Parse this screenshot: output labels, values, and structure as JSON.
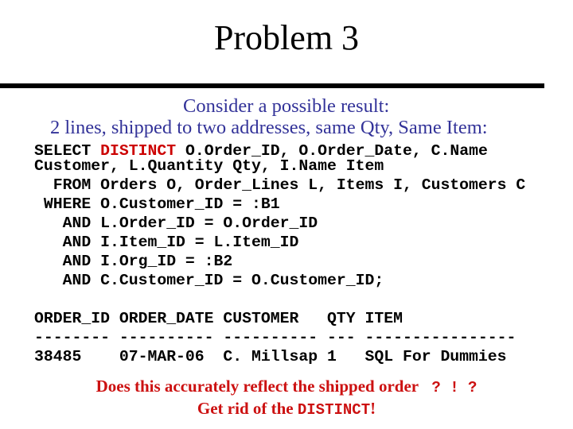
{
  "slide": {
    "title": "Problem 3",
    "subtitle_lines": [
      "Consider a possible result:",
      "2 lines, shipped to two addresses, same Qty, Same Item:"
    ],
    "colors": {
      "title": "#000000",
      "subtitle": "#333399",
      "code": "#000000",
      "highlight": "#cc0000"
    }
  },
  "sql": {
    "line1_prefix": "SELECT ",
    "line1_keyword": "DISTINCT",
    "line1_rest": " O.Order_ID, O.Order_Date, C.Name",
    "line2": "Customer, L.Quantity Qty, I.Name Item",
    "lines": [
      "  FROM Orders O, Order_Lines L, Items I, Customers C",
      " WHERE O.Customer_ID = :B1",
      "   AND L.Order_ID = O.Order_ID",
      "   AND I.Item_ID = L.Item_ID",
      "   AND I.Org_ID = :B2",
      "   AND C.Customer_ID = O.Customer_ID;"
    ]
  },
  "result": {
    "header": "ORDER_ID ORDER_DATE CUSTOMER   QTY ITEM",
    "separator": "-------- ---------- ---------- --- ----------------",
    "columns": [
      "ORDER_ID",
      "ORDER_DATE",
      "CUSTOMER",
      "QTY",
      "ITEM"
    ],
    "rows": [
      {
        "text": "38485    07-MAR-06  C. Millsap 1   SQL For Dummies",
        "ORDER_ID": "38485",
        "ORDER_DATE": "07-MAR-06",
        "CUSTOMER": "C. Millsap",
        "QTY": "1",
        "ITEM": "SQL For Dummies"
      }
    ]
  },
  "conclusion": {
    "question": "Does this accurately reflect the shipped order ",
    "question_marks": " ? ! ?",
    "action_prefix": "Get rid of the ",
    "action_code": "DISTINCT",
    "action_suffix": "!"
  }
}
